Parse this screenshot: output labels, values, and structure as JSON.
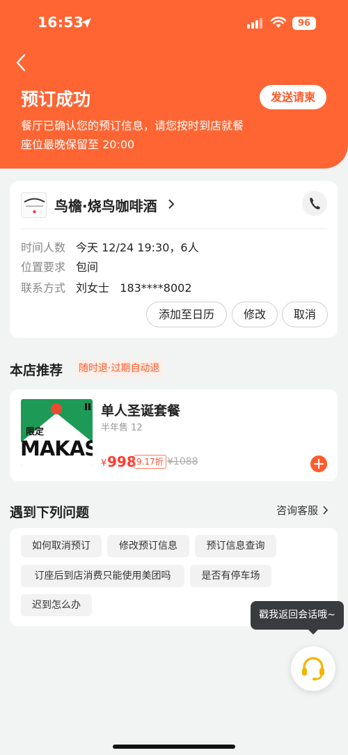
{
  "status_bar": {
    "time": "16:53",
    "battery": "96"
  },
  "header": {
    "title": "预订成功",
    "send_invite": "发送请柬",
    "subtitle_line1": "餐厅已确认您的预订信息，请您按时到店就餐",
    "subtitle_line2": "座位最晚保留至 20:00"
  },
  "reservation": {
    "store_name": "鸟檐·烧鸟咖啡酒",
    "rows": [
      {
        "label": "时间人数",
        "value": "今天 12/24 19:30，6人"
      },
      {
        "label": "位置要求",
        "value": "包间"
      },
      {
        "label": "联系方式",
        "value": "刘女士   183****8002"
      }
    ],
    "actions": [
      "添加至日历",
      "修改",
      "取消"
    ]
  },
  "recommend": {
    "title": "本店推荐",
    "tag": "随时退·过期自动退",
    "deal": {
      "img_text_top": "限定",
      "img_text_main": "MAKAS",
      "title": "单人圣诞套餐",
      "sales": "半年售 12",
      "currency": "¥",
      "price": "998",
      "discount": "9.17折",
      "original_price": "¥1088"
    }
  },
  "faq": {
    "title": "遇到下列问题",
    "consult": "咨询客服",
    "chips": [
      "如何取消预订",
      "修改预订信息",
      "预订信息查询",
      "订座后到店消费只能使用美团吗",
      "是否有停车场",
      "迟到怎么办"
    ]
  },
  "tooltip": "戳我返回会话哦~",
  "colors": {
    "brand": "#fe6533",
    "price": "#fe3b2c",
    "support_icon": "#f5b400"
  }
}
